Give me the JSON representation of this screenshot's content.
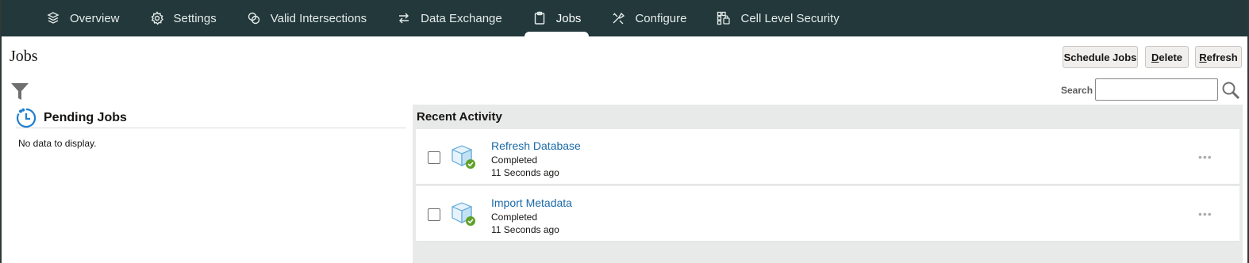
{
  "nav": {
    "tabs": [
      {
        "label": "Overview",
        "icon": "cube-stack-icon"
      },
      {
        "label": "Settings",
        "icon": "gear-icon"
      },
      {
        "label": "Valid Intersections",
        "icon": "intersect-icon"
      },
      {
        "label": "Data Exchange",
        "icon": "exchange-arrows-icon"
      },
      {
        "label": "Jobs",
        "icon": "clipboard-icon",
        "active": true
      },
      {
        "label": "Configure",
        "icon": "tools-icon"
      },
      {
        "label": "Cell Level Security",
        "icon": "grid-security-icon"
      }
    ]
  },
  "page": {
    "title": "Jobs",
    "buttons": {
      "schedule": "Schedule Jobs",
      "delete_first": "D",
      "delete_rest": "elete",
      "refresh_first": "R",
      "refresh_rest": "efresh"
    },
    "search_label": "Search"
  },
  "pending": {
    "title": "Pending Jobs",
    "empty_text": "No data to display."
  },
  "recent": {
    "title": "Recent Activity",
    "items": [
      {
        "name": "Refresh Database",
        "status": "Completed",
        "time": "11 Seconds ago"
      },
      {
        "name": "Import Metadata",
        "status": "Completed",
        "time": "11 Seconds ago"
      }
    ]
  },
  "colors": {
    "nav_bg": "#22383a",
    "link": "#1a6aa6",
    "success": "#5fa12a",
    "accent_blue": "#1f7fd0"
  }
}
